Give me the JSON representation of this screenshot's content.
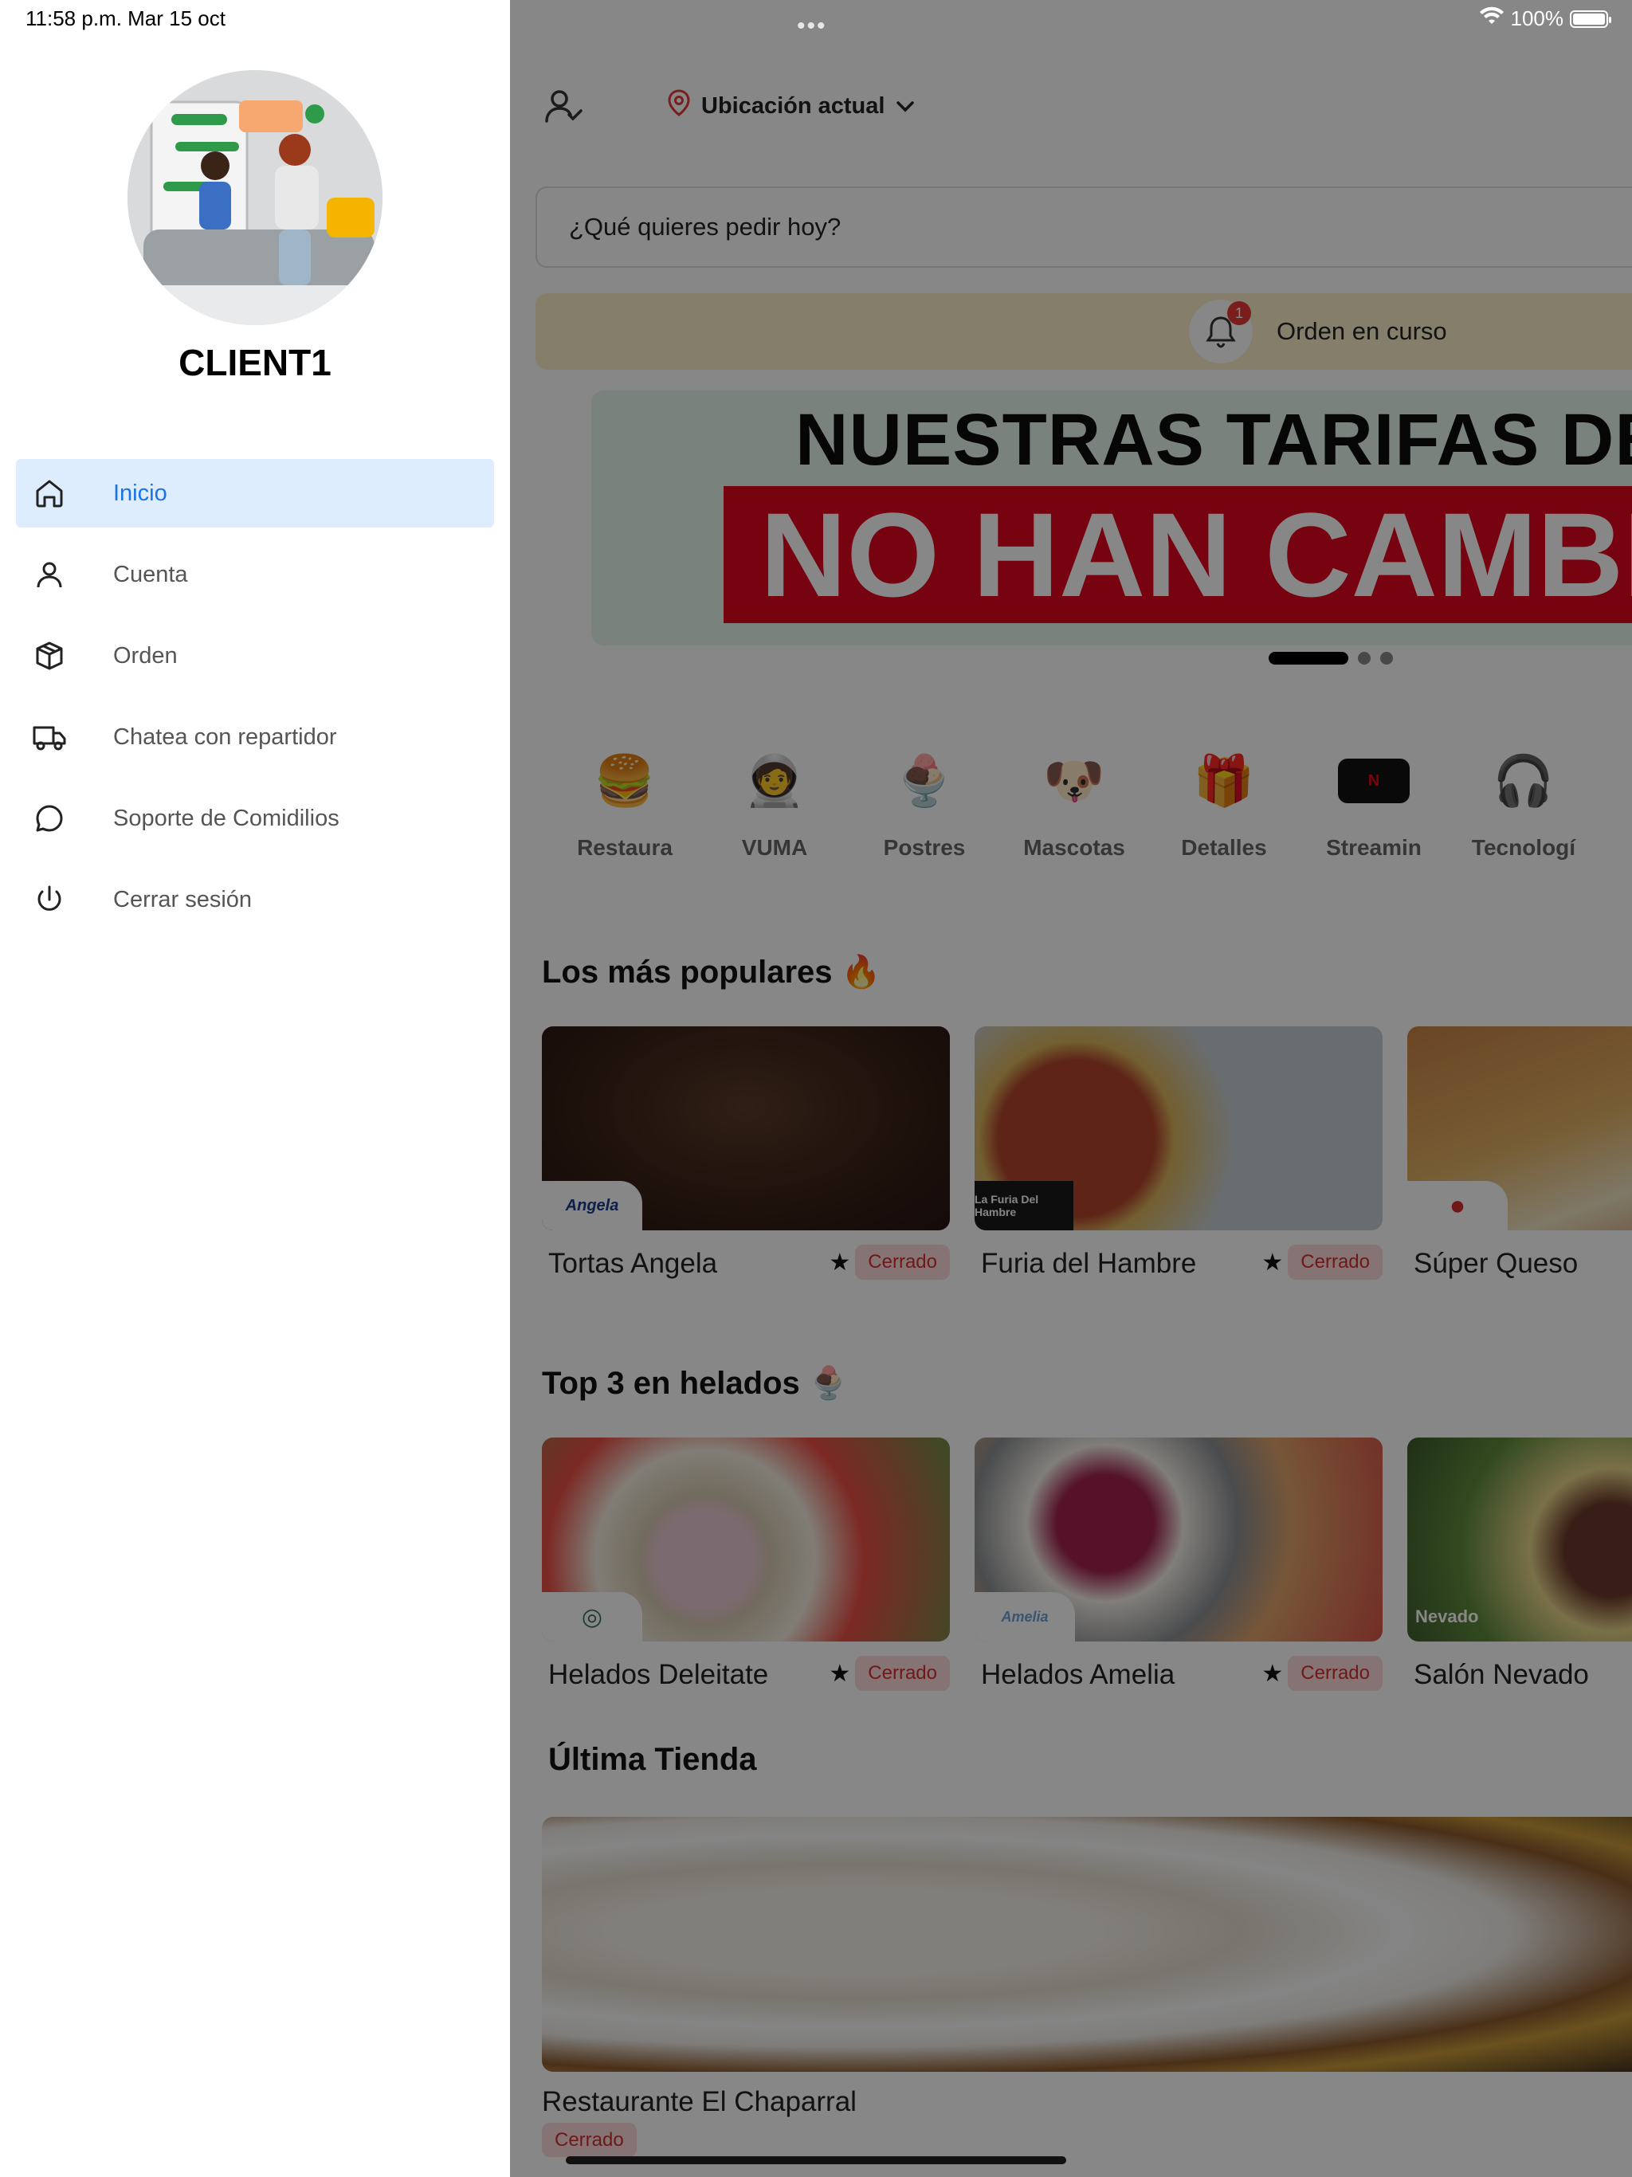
{
  "status_bar": {
    "time": "11:58 p.m.   Mar 15 oct",
    "dots": "•••",
    "battery": "100%"
  },
  "sidebar": {
    "client_name": "CLIENT1",
    "items": [
      {
        "label": "Inicio",
        "icon": "home-icon",
        "active": true
      },
      {
        "label": "Cuenta",
        "icon": "user-icon",
        "active": false
      },
      {
        "label": "Orden",
        "icon": "box-icon",
        "active": false
      },
      {
        "label": "Chatea con repartidor",
        "icon": "truck-icon",
        "active": false
      },
      {
        "label": "Soporte de Comidilios",
        "icon": "chat-bubble-icon",
        "active": false
      },
      {
        "label": "Cerrar sesión",
        "icon": "power-icon",
        "active": false
      }
    ]
  },
  "header": {
    "location": "Ubicación actual"
  },
  "search": {
    "placeholder": "¿Qué quieres pedir hoy?"
  },
  "order_bar": {
    "label": "Orden en curso",
    "badge_count": "1"
  },
  "banner": {
    "line1": "NUESTRAS TARIFAS DE E",
    "line2": "NO HAN CAMBIA"
  },
  "categories": [
    {
      "label": "Restaura",
      "icon": "burger-icon"
    },
    {
      "label": "VUMA",
      "icon": "delivery-mascot-icon"
    },
    {
      "label": "Postres",
      "icon": "dessert-icon"
    },
    {
      "label": "Mascotas",
      "icon": "pets-icon"
    },
    {
      "label": "Detalles",
      "icon": "gift-icon"
    },
    {
      "label": "Streamin",
      "icon": "netflix-icon"
    },
    {
      "label": "Tecnologí",
      "icon": "headphones-icon"
    }
  ],
  "sections": {
    "popular_title": "Los más populares 🔥",
    "helados_title": "Top 3 en helados 🍨",
    "last_title": "Última Tienda"
  },
  "popular": [
    {
      "name": "Tortas Angela",
      "logo": "Angela",
      "status": "Cerrado"
    },
    {
      "name": "Furia del Hambre",
      "logo": "La Furia Del Hambre",
      "status": "Cerrado"
    },
    {
      "name": "Súper Queso",
      "logo": "",
      "status": ""
    }
  ],
  "helados": [
    {
      "name": "Helados Deleitate",
      "logo": "",
      "status": "Cerrado"
    },
    {
      "name": "Helados Amelia",
      "logo": "Amelia",
      "status": "Cerrado"
    },
    {
      "name": "Salón Nevado",
      "logo": "Nevado",
      "status": ""
    }
  ],
  "last_store": {
    "name": "Restaurante El Chaparral",
    "status": "Cerrado"
  }
}
